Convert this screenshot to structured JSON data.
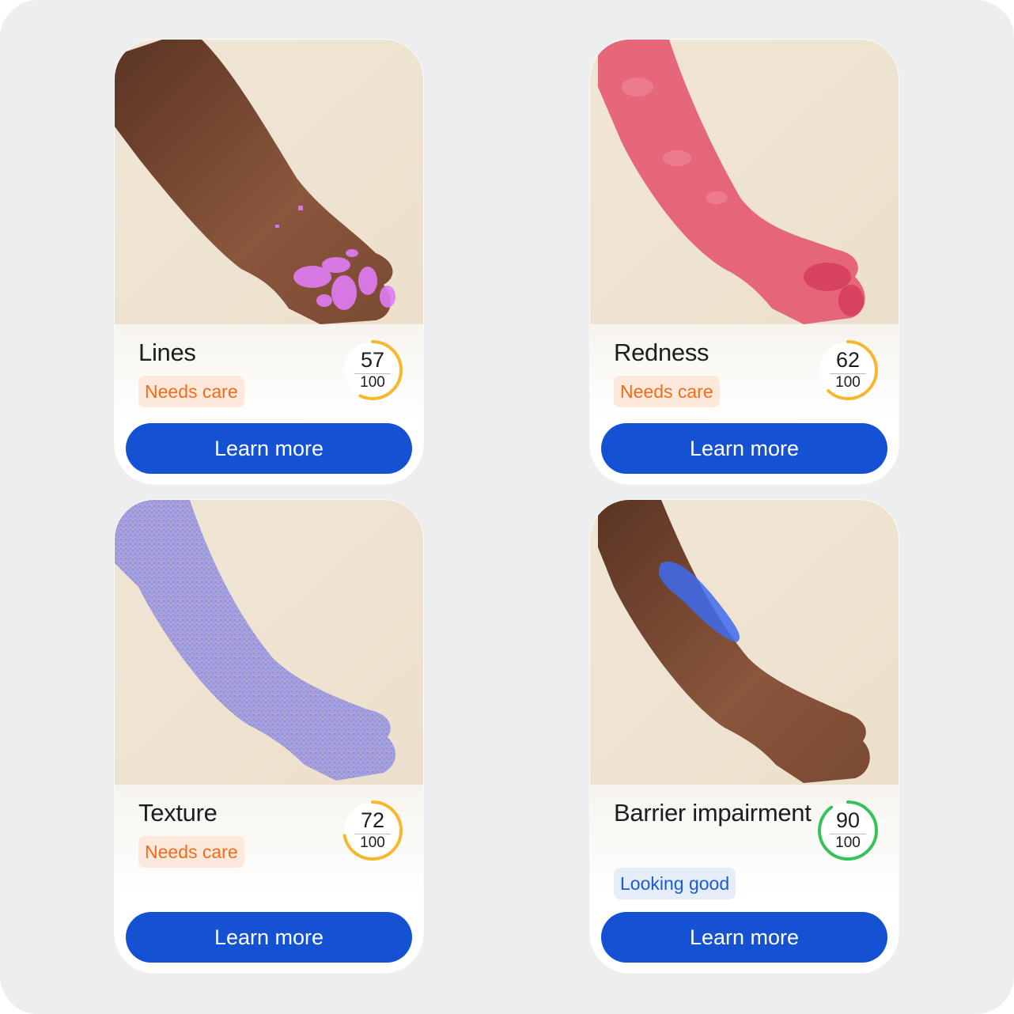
{
  "cards": [
    {
      "title": "Lines",
      "status": "Needs care",
      "status_kind": "warn",
      "score": "57",
      "max": "100",
      "score_value": 57,
      "ring_color": "#f5b82e",
      "button_label": "Learn more",
      "overlay_color": "#e07cf5"
    },
    {
      "title": "Redness",
      "status": "Needs care",
      "status_kind": "warn",
      "score": "62",
      "max": "100",
      "score_value": 62,
      "ring_color": "#f5b82e",
      "button_label": "Learn more",
      "overlay_color": "#e4506a"
    },
    {
      "title": "Texture",
      "status": "Needs care",
      "status_kind": "warn",
      "score": "72",
      "max": "100",
      "score_value": 72,
      "ring_color": "#f5b82e",
      "button_label": "Learn more",
      "overlay_color": "#9d9ee8"
    },
    {
      "title": "Barrier impairment",
      "status": "Looking good",
      "status_kind": "good",
      "score": "90",
      "max": "100",
      "score_value": 90,
      "ring_color": "#35c35a",
      "button_label": "Learn more",
      "overlay_color": "#3d6bf0"
    }
  ]
}
